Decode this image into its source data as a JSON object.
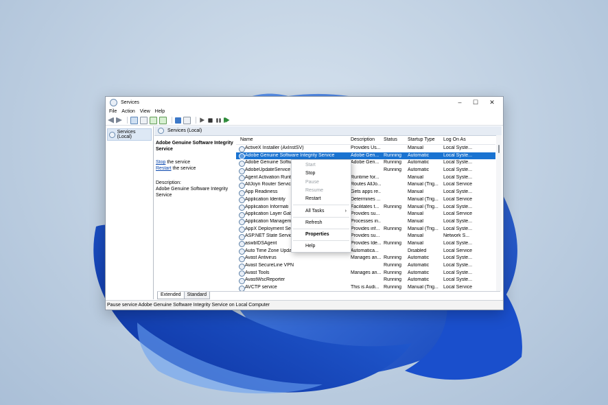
{
  "window": {
    "title": "Services"
  },
  "menu": [
    "File",
    "Action",
    "View",
    "Help"
  ],
  "tree": {
    "root": "Services (Local)"
  },
  "panel": {
    "header": "Services (Local)",
    "selected_name": "Adobe Genuine Software Integrity Service",
    "stop_link": "Stop",
    "stop_suffix": " the service",
    "restart_link": "Restart",
    "restart_suffix": " the service",
    "desc_label": "Description:",
    "desc_text": "Adobe Genuine Software Integrity Service"
  },
  "columns": [
    "Name",
    "Description",
    "Status",
    "Startup Type",
    "Log On As"
  ],
  "rows": [
    {
      "name": "ActiveX Installer (AxInstSV)",
      "desc": "Provides Us...",
      "status": "",
      "startup": "Manual",
      "logon": "Local Syste..."
    },
    {
      "name": "Adobe Genuine Software Integrity Service",
      "desc": "Adobe Gen...",
      "status": "Running",
      "startup": "Automatic",
      "logon": "Local Syste..."
    },
    {
      "name": "Adobe Genuine Software",
      "desc": "Adobe Gen...",
      "status": "Running",
      "startup": "Automatic",
      "logon": "Local Syste..."
    },
    {
      "name": "AdobeUpdateService",
      "desc": "",
      "status": "Running",
      "startup": "Automatic",
      "logon": "Local Syste..."
    },
    {
      "name": "Agent Activation Runt",
      "desc": "Runtime for...",
      "status": "",
      "startup": "Manual",
      "logon": "Local Syste..."
    },
    {
      "name": "AllJoyn Router Service",
      "desc": "Routes AllJo...",
      "status": "",
      "startup": "Manual (Trig...",
      "logon": "Local Service"
    },
    {
      "name": "App Readiness",
      "desc": "Gets apps re...",
      "status": "",
      "startup": "Manual",
      "logon": "Local Syste..."
    },
    {
      "name": "Application Identity",
      "desc": "Determines ...",
      "status": "",
      "startup": "Manual (Trig...",
      "logon": "Local Service"
    },
    {
      "name": "Application Informati",
      "desc": "Facilitates t...",
      "status": "Running",
      "startup": "Manual (Trig...",
      "logon": "Local Syste..."
    },
    {
      "name": "Application Layer Gate",
      "desc": "Provides su...",
      "status": "",
      "startup": "Manual",
      "logon": "Local Service"
    },
    {
      "name": "Application Managem",
      "desc": "Processes in...",
      "status": "",
      "startup": "Manual",
      "logon": "Local Syste..."
    },
    {
      "name": "AppX Deployment Serv",
      "desc": "Provides inf...",
      "status": "Running",
      "startup": "Manual (Trig...",
      "logon": "Local Syste..."
    },
    {
      "name": "ASP.NET State Service",
      "desc": "Provides su...",
      "status": "",
      "startup": "Manual",
      "logon": "Network S..."
    },
    {
      "name": "aswbIDSAgent",
      "desc": "Provides Ide...",
      "status": "Running",
      "startup": "Manual",
      "logon": "Local Syste..."
    },
    {
      "name": "Auto Time Zone Updater",
      "desc": "Automatica...",
      "status": "",
      "startup": "Disabled",
      "logon": "Local Service"
    },
    {
      "name": "Avast Antivirus",
      "desc": "Manages an...",
      "status": "Running",
      "startup": "Automatic",
      "logon": "Local Syste..."
    },
    {
      "name": "Avast SecureLine VPN",
      "desc": "",
      "status": "Running",
      "startup": "Automatic",
      "logon": "Local Syste..."
    },
    {
      "name": "Avast Tools",
      "desc": "Manages an...",
      "status": "Running",
      "startup": "Automatic",
      "logon": "Local Syste..."
    },
    {
      "name": "AvastWscReporter",
      "desc": "",
      "status": "Running",
      "startup": "Automatic",
      "logon": "Local Syste..."
    },
    {
      "name": "AVCTP service",
      "desc": "This is Audi...",
      "status": "Running",
      "startup": "Manual (Trig...",
      "logon": "Local Service"
    }
  ],
  "context_menu": {
    "start": "Start",
    "stop": "Stop",
    "pause": "Pause",
    "resume": "Resume",
    "restart": "Restart",
    "all_tasks": "All Tasks",
    "refresh": "Refresh",
    "properties": "Properties",
    "help": "Help"
  },
  "tabs": [
    "Extended",
    "Standard"
  ],
  "status_bar": "Pause service Adobe Genuine Software Integrity Service on Local Computer",
  "colors": {
    "selection": "#1a73d1",
    "wallpaper_blue": "#1f5ed6",
    "link": "#0645ad"
  }
}
